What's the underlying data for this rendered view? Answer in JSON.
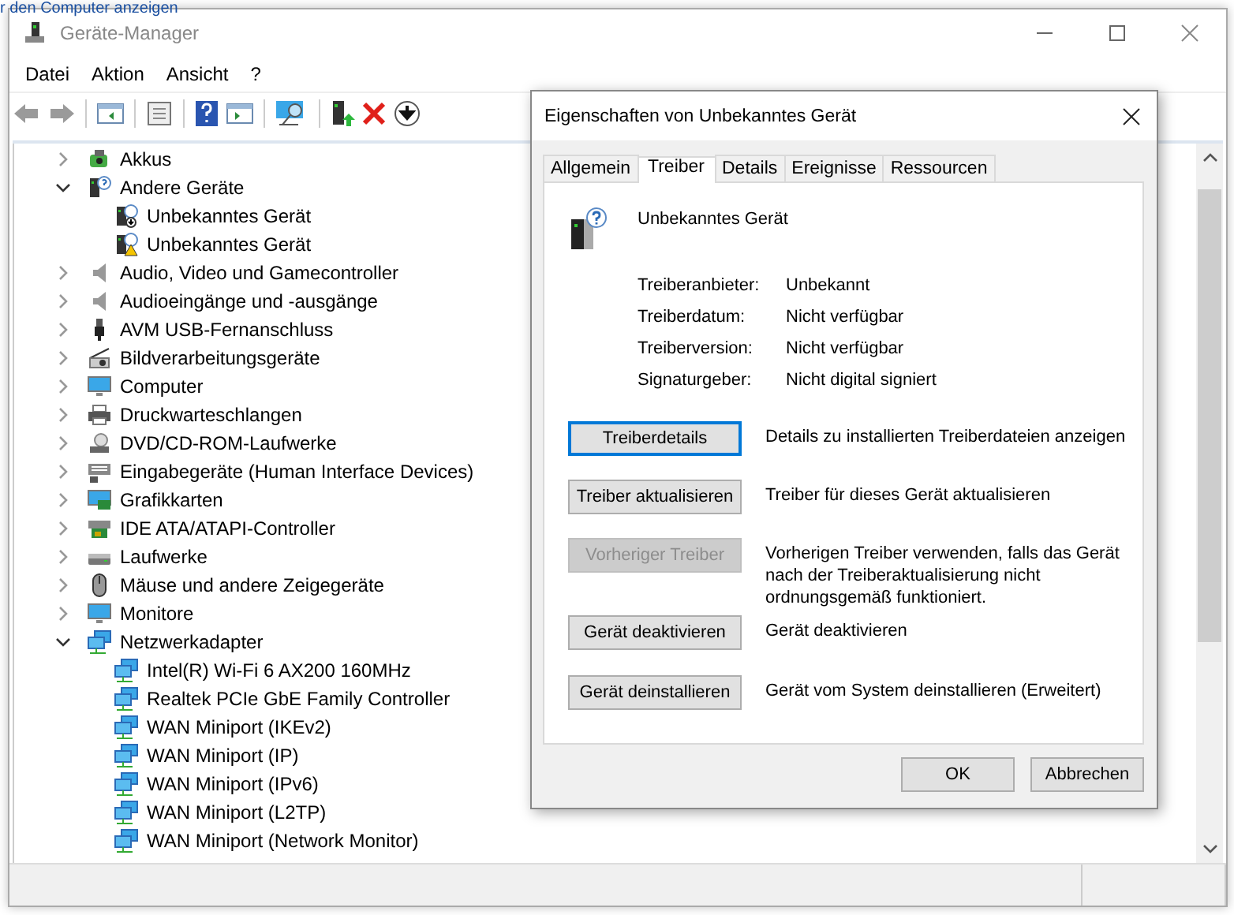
{
  "background_text": "r den Computer anzeigen",
  "window": {
    "title": "Geräte-Manager"
  },
  "menu": [
    "Datei",
    "Aktion",
    "Ansicht",
    "?"
  ],
  "tree": [
    {
      "label": "Akkus",
      "kind": "battery",
      "expanded": false
    },
    {
      "label": "Andere Geräte",
      "kind": "unknown",
      "expanded": true,
      "children": [
        {
          "label": "Unbekanntes Gerät",
          "kind": "unknown-download"
        },
        {
          "label": "Unbekanntes Gerät",
          "kind": "unknown-warning"
        }
      ]
    },
    {
      "label": "Audio, Video und Gamecontroller",
      "kind": "speaker",
      "expanded": false
    },
    {
      "label": "Audioeingänge und -ausgänge",
      "kind": "speaker",
      "expanded": false
    },
    {
      "label": "AVM USB-Fernanschluss",
      "kind": "usb",
      "expanded": false
    },
    {
      "label": "Bildverarbeitungsgeräte",
      "kind": "camera",
      "expanded": false
    },
    {
      "label": "Computer",
      "kind": "monitor",
      "expanded": false
    },
    {
      "label": "Druckwarteschlangen",
      "kind": "printer",
      "expanded": false
    },
    {
      "label": "DVD/CD-ROM-Laufwerke",
      "kind": "disc",
      "expanded": false
    },
    {
      "label": "Eingabegeräte (Human Interface Devices)",
      "kind": "keyboard",
      "expanded": false
    },
    {
      "label": "Grafikkarten",
      "kind": "graphics",
      "expanded": false
    },
    {
      "label": "IDE ATA/ATAPI-Controller",
      "kind": "chip",
      "expanded": false
    },
    {
      "label": "Laufwerke",
      "kind": "drive",
      "expanded": false
    },
    {
      "label": "Mäuse und andere Zeigegeräte",
      "kind": "mouse",
      "expanded": false
    },
    {
      "label": "Monitore",
      "kind": "monitor",
      "expanded": false
    },
    {
      "label": "Netzwerkadapter",
      "kind": "network",
      "expanded": true,
      "children": [
        {
          "label": "Intel(R) Wi-Fi 6 AX200 160MHz",
          "kind": "network"
        },
        {
          "label": "Realtek PCIe GbE Family Controller",
          "kind": "network"
        },
        {
          "label": "WAN Miniport (IKEv2)",
          "kind": "network"
        },
        {
          "label": "WAN Miniport (IP)",
          "kind": "network"
        },
        {
          "label": "WAN Miniport (IPv6)",
          "kind": "network"
        },
        {
          "label": "WAN Miniport (L2TP)",
          "kind": "network"
        },
        {
          "label": "WAN Miniport (Network Monitor)",
          "kind": "network"
        }
      ]
    }
  ],
  "dialog": {
    "title": "Eigenschaften von Unbekanntes Gerät",
    "tabs": [
      {
        "label": "Allgemein",
        "selected": false
      },
      {
        "label": "Treiber",
        "selected": true
      },
      {
        "label": "Details",
        "selected": false
      },
      {
        "label": "Ereignisse",
        "selected": false
      },
      {
        "label": "Ressourcen",
        "selected": false
      }
    ],
    "device_name": "Unbekanntes Gerät",
    "properties": [
      {
        "label": "Treiberanbieter:",
        "value": "Unbekannt"
      },
      {
        "label": "Treiberdatum:",
        "value": "Nicht verfügbar"
      },
      {
        "label": "Treiberversion:",
        "value": "Nicht verfügbar"
      },
      {
        "label": "Signaturgeber:",
        "value": "Nicht digital signiert"
      }
    ],
    "actions": [
      {
        "button": "Treiberdetails",
        "description": "Details zu installierten Treiberdateien anzeigen",
        "disabled": false,
        "focused": true
      },
      {
        "button": "Treiber aktualisieren",
        "description": "Treiber für dieses Gerät aktualisieren",
        "disabled": false,
        "focused": false
      },
      {
        "button": "Vorheriger Treiber",
        "description": "Vorherigen Treiber verwenden, falls das Gerät nach der Treiberaktualisierung nicht ordnungsgemäß funktioniert.",
        "disabled": true,
        "focused": false
      },
      {
        "button": "Gerät deaktivieren",
        "description": "Gerät deaktivieren",
        "disabled": false,
        "focused": false
      },
      {
        "button": "Gerät deinstallieren",
        "description": "Gerät vom System deinstallieren (Erweitert)",
        "disabled": false,
        "focused": false
      }
    ],
    "buttons": [
      "OK",
      "Abbrechen"
    ]
  }
}
